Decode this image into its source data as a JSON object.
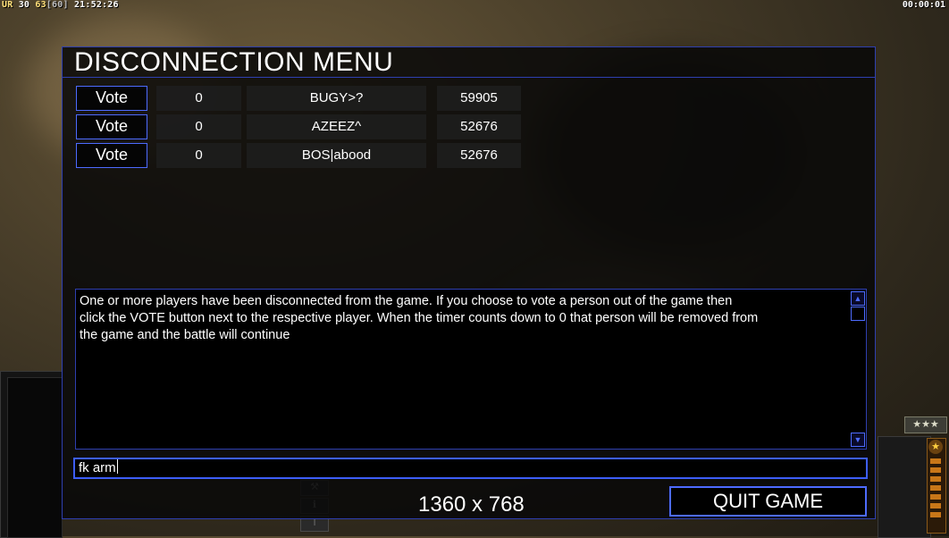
{
  "hud": {
    "ur_label": "UR",
    "ur_value": "30",
    "fps": "63",
    "fps_cap": "[60]",
    "clock": "21:52:26",
    "game_timer": "00:00:01"
  },
  "dialog": {
    "title": "DISCONNECTION MENU",
    "players": [
      {
        "vote_label": "Vote",
        "votes": "0",
        "name": "BUGY>?",
        "ping": "59905"
      },
      {
        "vote_label": "Vote",
        "votes": "0",
        "name": "AZEEZ^",
        "ping": "52676"
      },
      {
        "vote_label": "Vote",
        "votes": "0",
        "name": "BOS|abood",
        "ping": "52676"
      }
    ],
    "message": "One or more players have been disconnected from the game. If you choose to vote a person out of the game then\n click the VOTE button next to the respective player. When the timer counts down to 0 that person will be removed from\n the game and the battle will continue",
    "chat_value": "fk arm",
    "resolution": "1360 x 768",
    "quit_label": "QUIT GAME"
  },
  "colors": {
    "accent": "#4d6bff",
    "border": "#2e3fb0",
    "panel": "#0c0c0c"
  }
}
